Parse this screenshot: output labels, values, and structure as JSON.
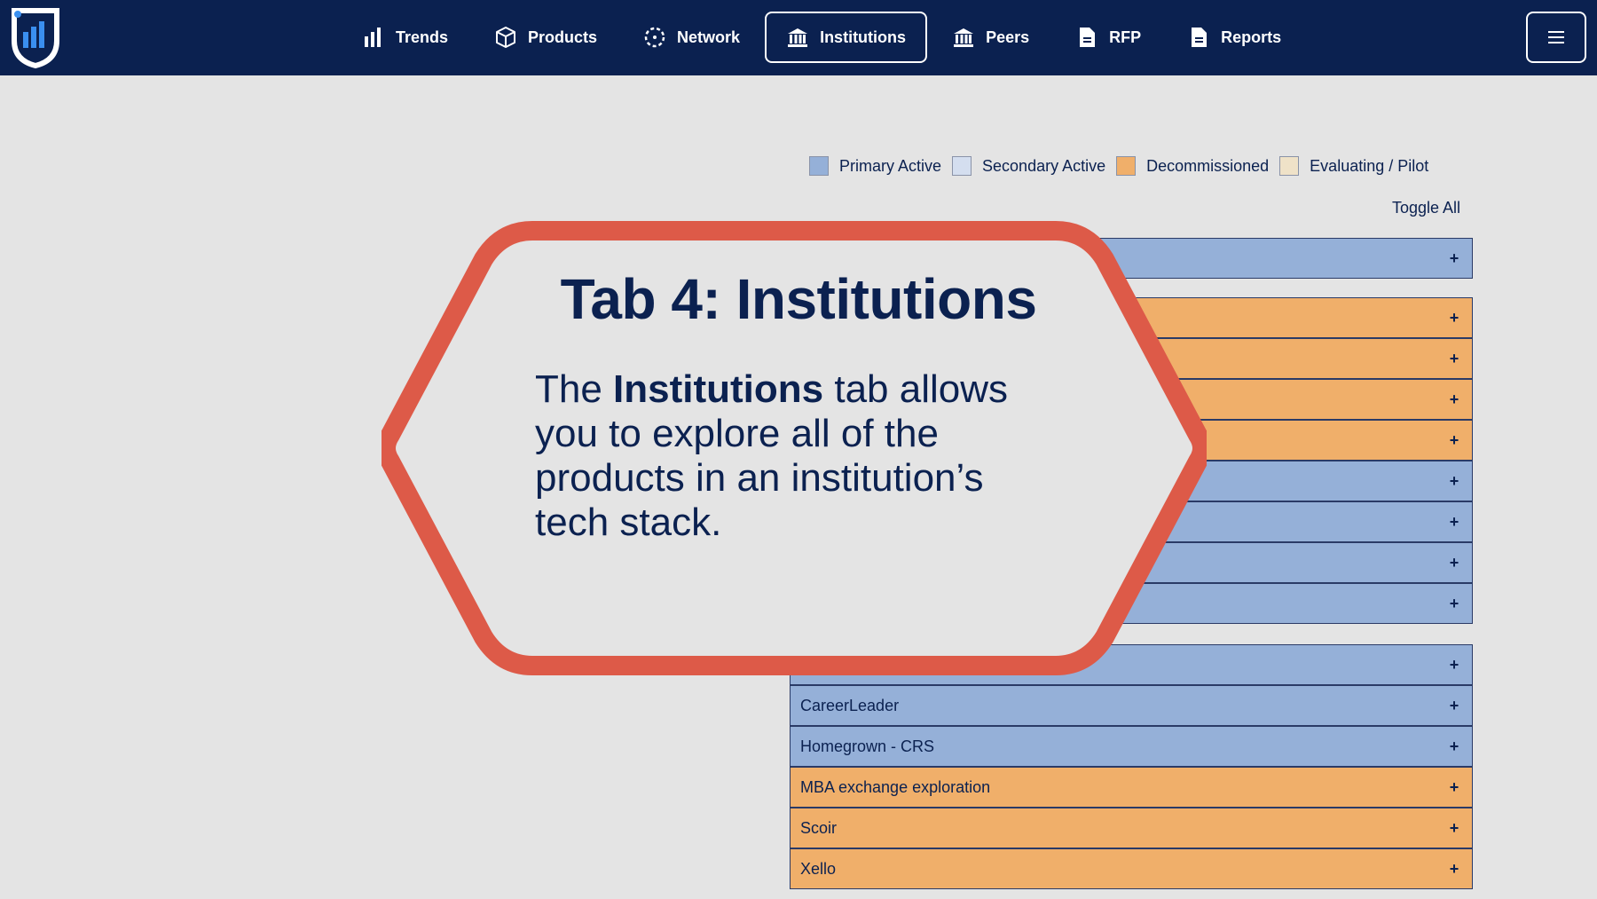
{
  "nav": {
    "items": [
      {
        "label": "Trends",
        "icon": "bar-chart-icon"
      },
      {
        "label": "Products",
        "icon": "box-icon"
      },
      {
        "label": "Network",
        "icon": "network-icon"
      },
      {
        "label": "Institutions",
        "icon": "bank-icon",
        "active": true
      },
      {
        "label": "Peers",
        "icon": "bank-icon"
      },
      {
        "label": "RFP",
        "icon": "document-icon"
      },
      {
        "label": "Reports",
        "icon": "document-icon"
      }
    ],
    "menu_icon": "hamburger-icon"
  },
  "legend": {
    "items": [
      {
        "label": "Primary Active",
        "color": "#95b0d8"
      },
      {
        "label": "Secondary Active",
        "color": "#d4deef"
      },
      {
        "label": "Decommissioned",
        "color": "#f0af6a"
      },
      {
        "label": "Evaluating / Pilot",
        "color": "#efe2c8"
      }
    ]
  },
  "toggle_all": "Toggle All",
  "rows": [
    {
      "label": "",
      "status": "primary"
    },
    {
      "label": "",
      "status": "decom"
    },
    {
      "label": "",
      "status": "decom"
    },
    {
      "label": "",
      "status": "decom"
    },
    {
      "label": "",
      "status": "decom"
    },
    {
      "label": "",
      "status": "primary"
    },
    {
      "label": "",
      "status": "primary"
    },
    {
      "label": "",
      "status": "primary"
    },
    {
      "label": "",
      "status": "primary"
    },
    {
      "label": "",
      "status": "primary"
    },
    {
      "label": "CareerLeader",
      "status": "primary"
    },
    {
      "label": "Homegrown - CRS",
      "status": "primary"
    },
    {
      "label": "MBA exchange exploration",
      "status": "decom"
    },
    {
      "label": "Scoir",
      "status": "decom"
    },
    {
      "label": "Xello",
      "status": "decom"
    }
  ],
  "row_action": "+",
  "callout": {
    "title": "Tab 4: Institutions",
    "body_pre": "The ",
    "body_bold": "Institutions",
    "body_post": " tab allows you to explore all of the products in an institution’s tech stack."
  },
  "colors": {
    "navy": "#0b2150",
    "callout_border": "#dd5a48",
    "primary_active": "#95b0d8",
    "decommissioned": "#f0af6a"
  }
}
